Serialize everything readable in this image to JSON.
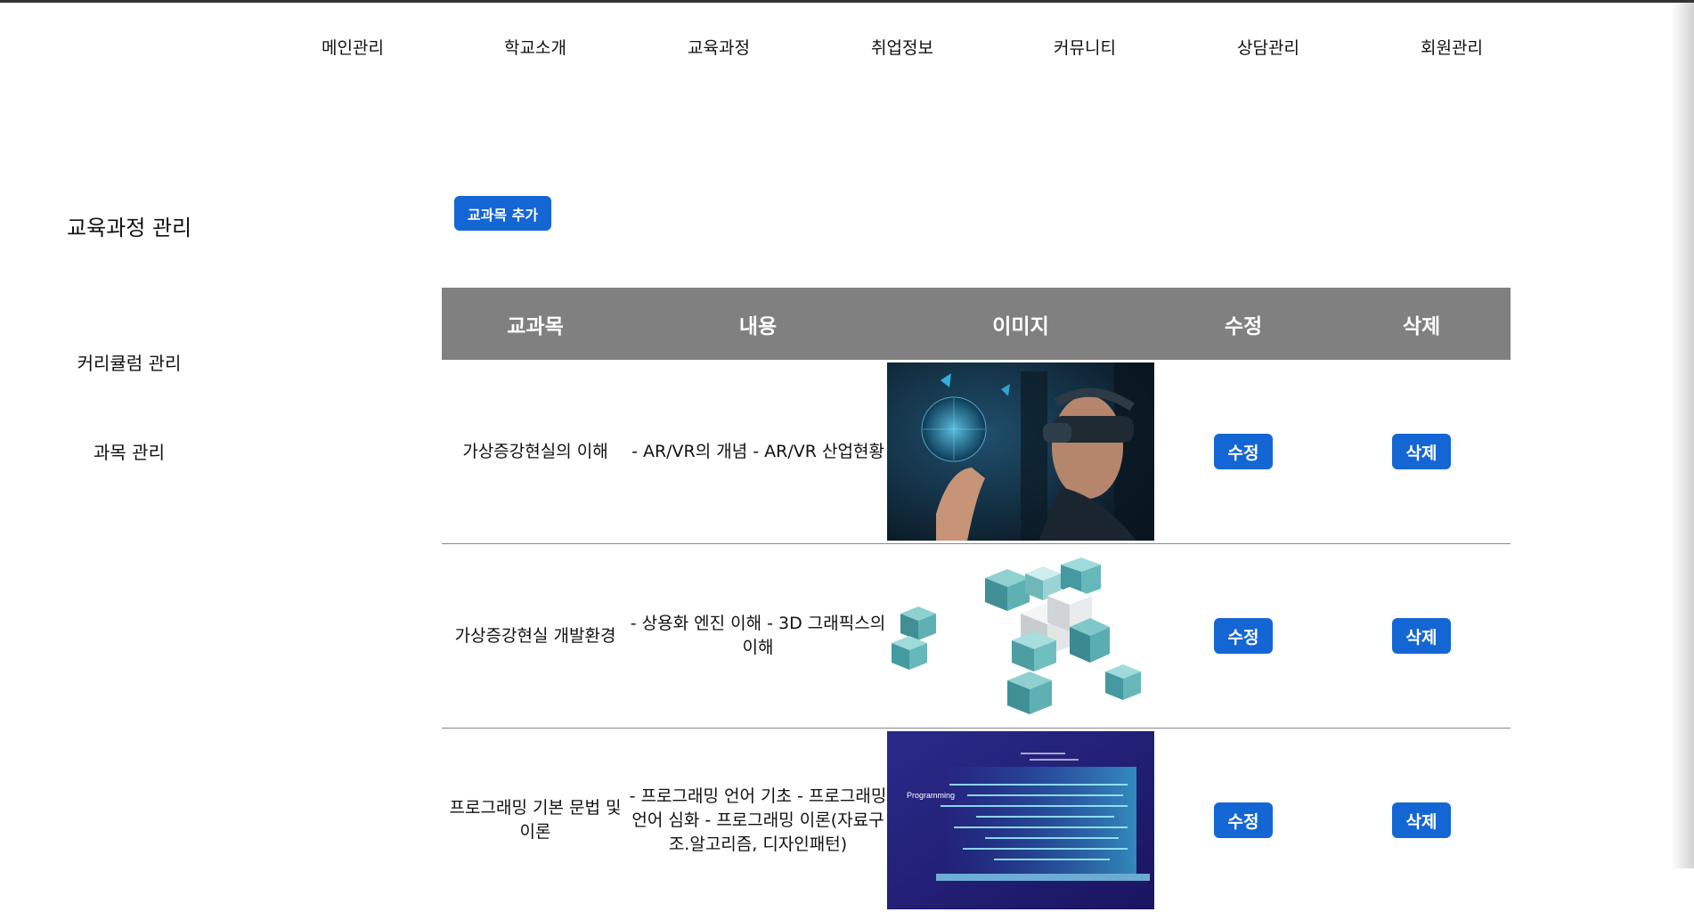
{
  "nav": {
    "items": [
      "메인관리",
      "학교소개",
      "교육과정",
      "취업정보",
      "커뮤니티",
      "상담관리",
      "회원관리"
    ]
  },
  "sidebar": {
    "title": "교육과정 관리",
    "items": [
      "커리큘럼 관리",
      "과목 관리"
    ]
  },
  "toolbar": {
    "add_label": "교과목 추가"
  },
  "table": {
    "headers": [
      "교과목",
      "내용",
      "이미지",
      "수정",
      "삭제"
    ],
    "rows": [
      {
        "name": "가상증강현실의 이해",
        "desc": "- AR/VR의 개념 - AR/VR 산업현황",
        "image": "vr-headset-photo",
        "edit": "수정",
        "delete": "삭제"
      },
      {
        "name": "가상증강현실 개발환경",
        "desc": "- 상용화 엔진 이해 - 3D 그래픽스의 이해",
        "image": "3d-cubes-graphic",
        "edit": "수정",
        "delete": "삭제"
      },
      {
        "name": "프로그래밍 기본 문법 및 이론",
        "desc": "- 프로그래밍 언어 기초 - 프로그래밍 언어 심화 - 프로그래밍 이론(자료구조.알고리즘, 디자인패턴)",
        "image": "programming-laptop-graphic",
        "image_text": "Programming",
        "edit": "수정",
        "delete": "삭제"
      }
    ]
  },
  "colors": {
    "accent": "#1466d4",
    "header_bg": "#808080",
    "divider": "#888888"
  }
}
